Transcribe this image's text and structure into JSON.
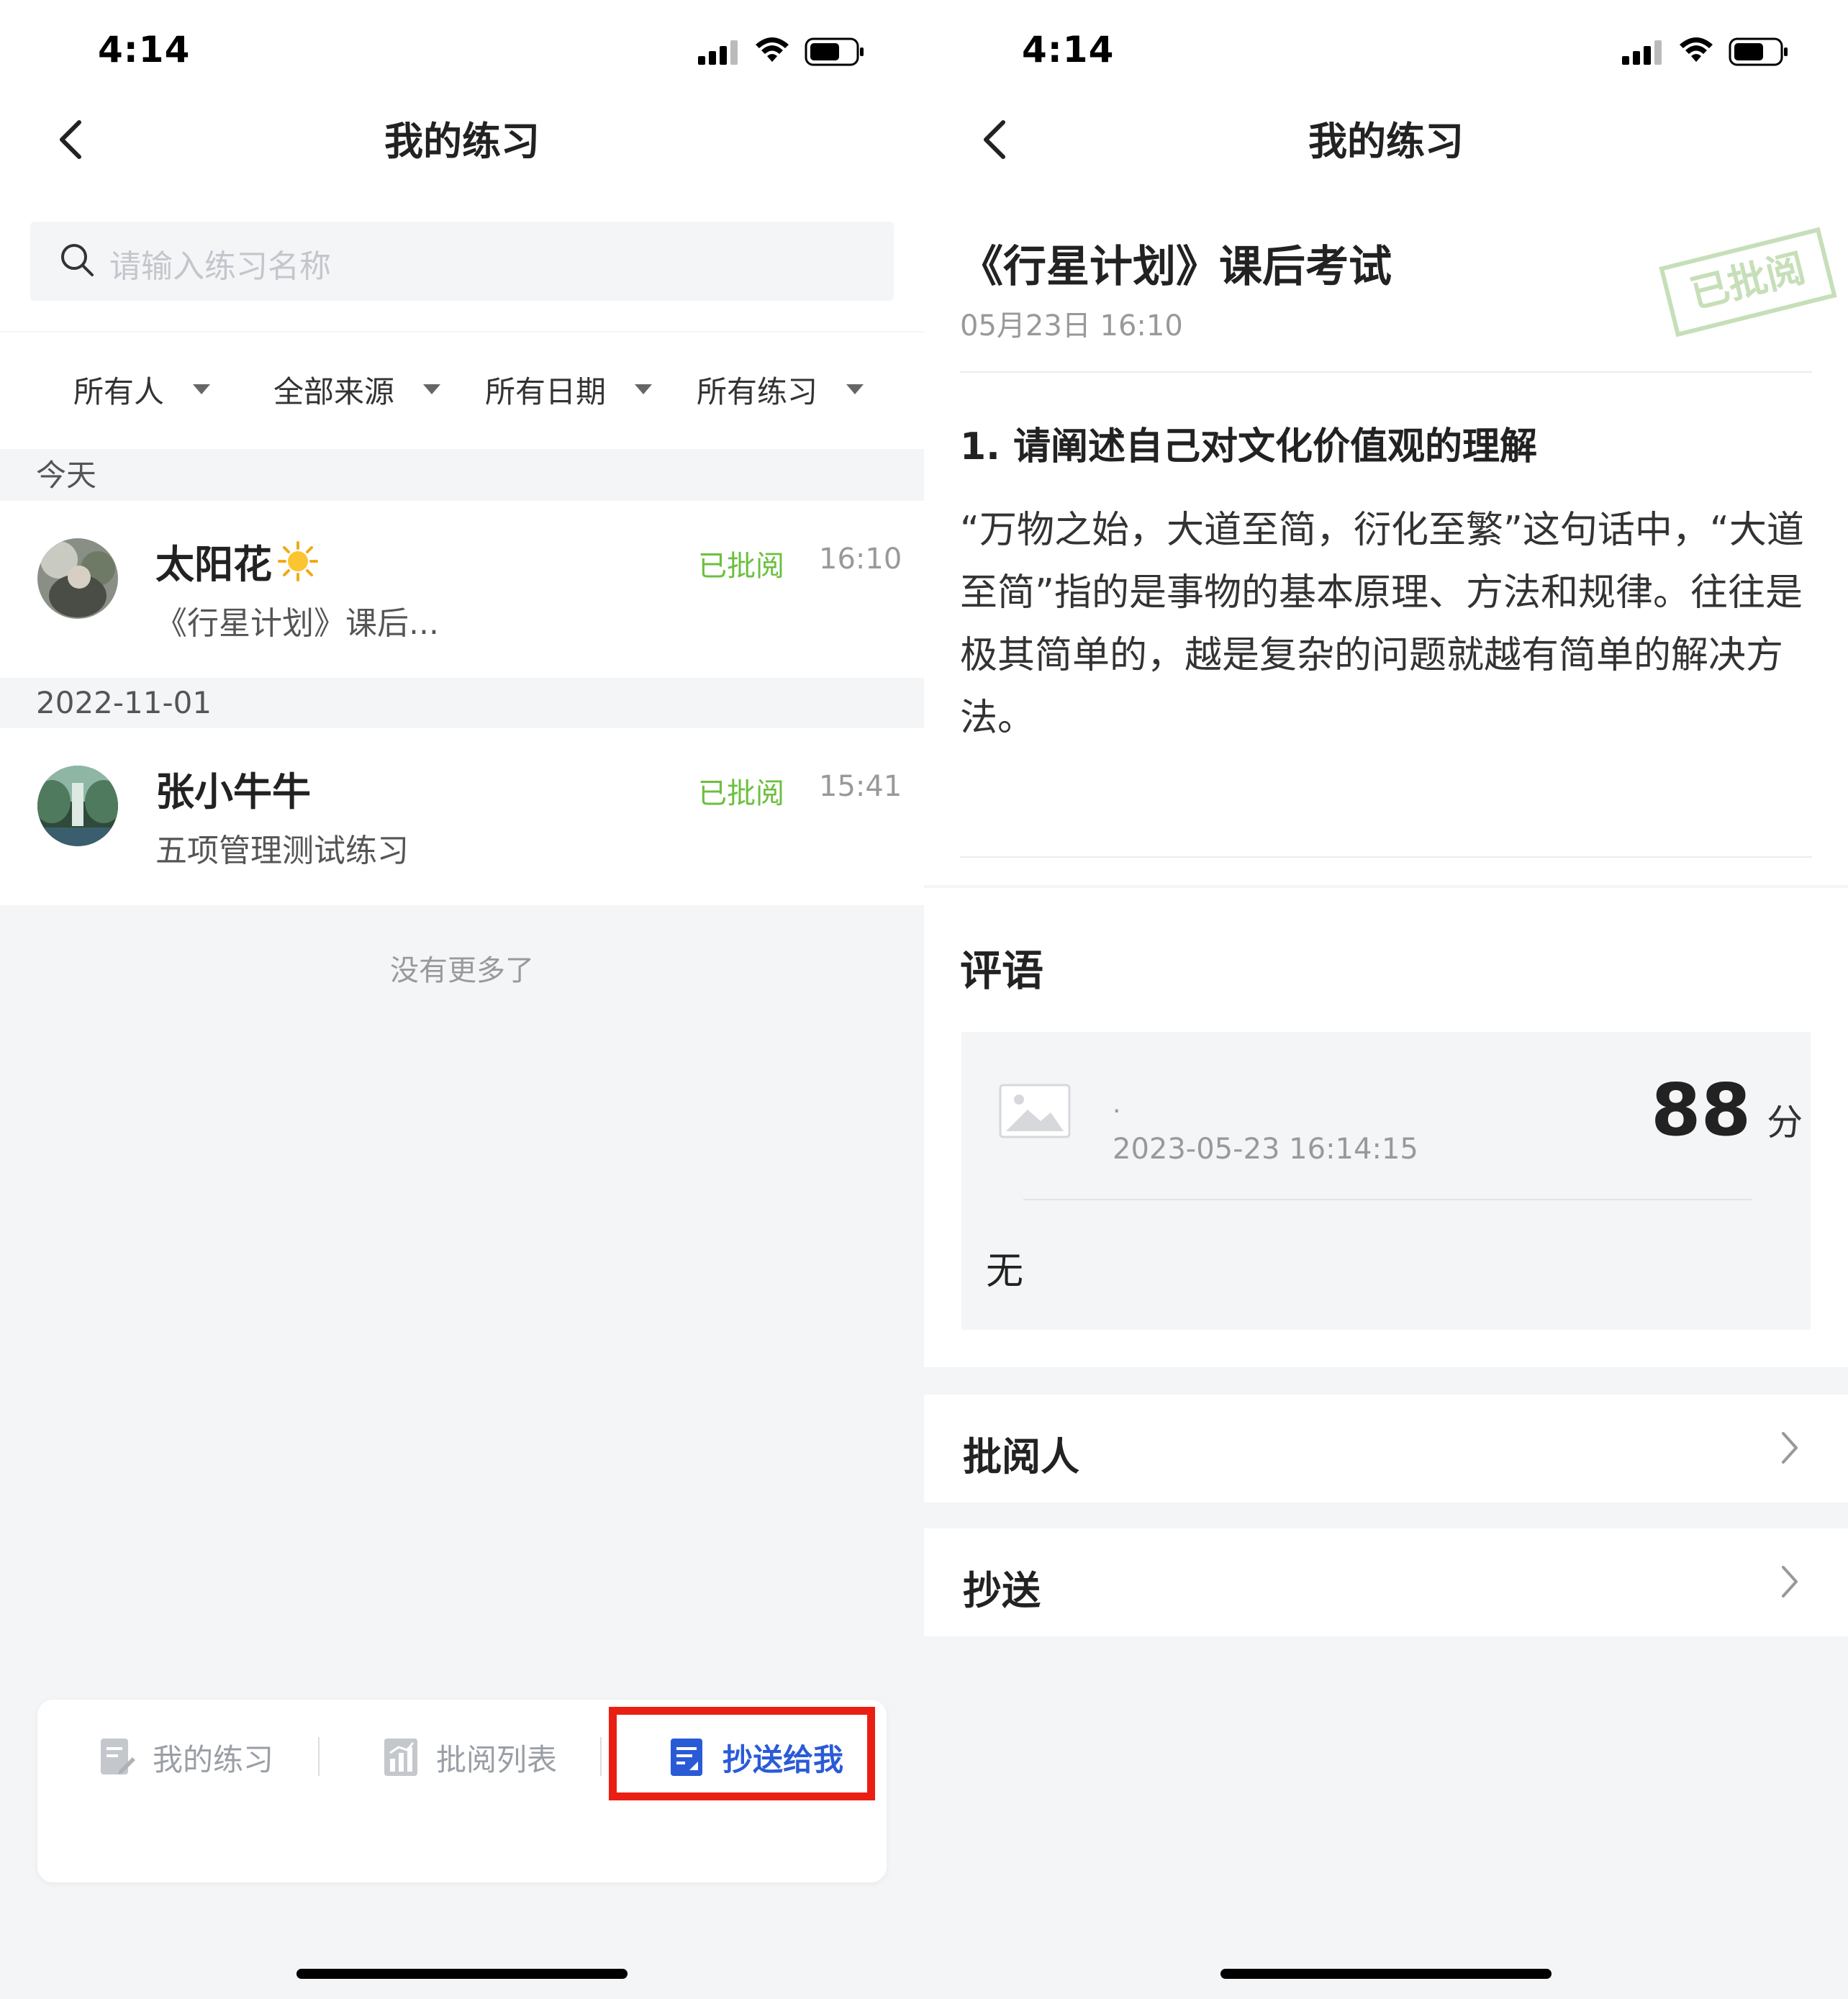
{
  "left": {
    "status": {
      "time": "4:14"
    },
    "nav": {
      "title": "我的练习"
    },
    "search": {
      "placeholder": "请输入练习名称"
    },
    "filters": [
      "所有人",
      "全部来源",
      "所有日期",
      "所有练习"
    ],
    "sections": [
      {
        "header": "今天",
        "item": {
          "name": "太阳花",
          "subtitle": "《行星计划》课后...",
          "status": "已批阅",
          "time": "16:10"
        }
      },
      {
        "header": "2022-11-01",
        "item": {
          "name": "张小牛牛",
          "subtitle": "五项管理测试练习",
          "status": "已批阅",
          "time": "15:41"
        }
      }
    ],
    "no_more": "没有更多了",
    "tabs": [
      {
        "label": "我的练习",
        "icon": "document-edit-icon"
      },
      {
        "label": "批阅列表",
        "icon": "chart-icon"
      },
      {
        "label": "抄送给我",
        "icon": "cc-list-icon"
      }
    ],
    "colors": {
      "status_green": "#6cbf3f",
      "active_tab": "#2a5bd7",
      "highlight_red": "#ea1f13"
    }
  },
  "right": {
    "status": {
      "time": "4:14"
    },
    "nav": {
      "title": "我的练习"
    },
    "exam": {
      "title": "《行星计划》课后考试",
      "date": "05月23日 16:10",
      "stamp": "已批阅"
    },
    "question": {
      "title": "1. 请阐述自己对文化价值观的理解",
      "answer": "“万物之始，大道至简，衍化至繁”这句话中，“大道至简”指的是事物的基本原理、方法和规律。往往是极其简单的，越是复杂的问题就越有简单的解决方法。"
    },
    "comment": {
      "title": "评语",
      "reviewer": "·",
      "time": "2023-05-23 16:14:15",
      "score": "88",
      "score_unit": "分",
      "text": "无"
    },
    "rows": [
      {
        "label": "批阅人"
      },
      {
        "label": "抄送"
      }
    ]
  }
}
